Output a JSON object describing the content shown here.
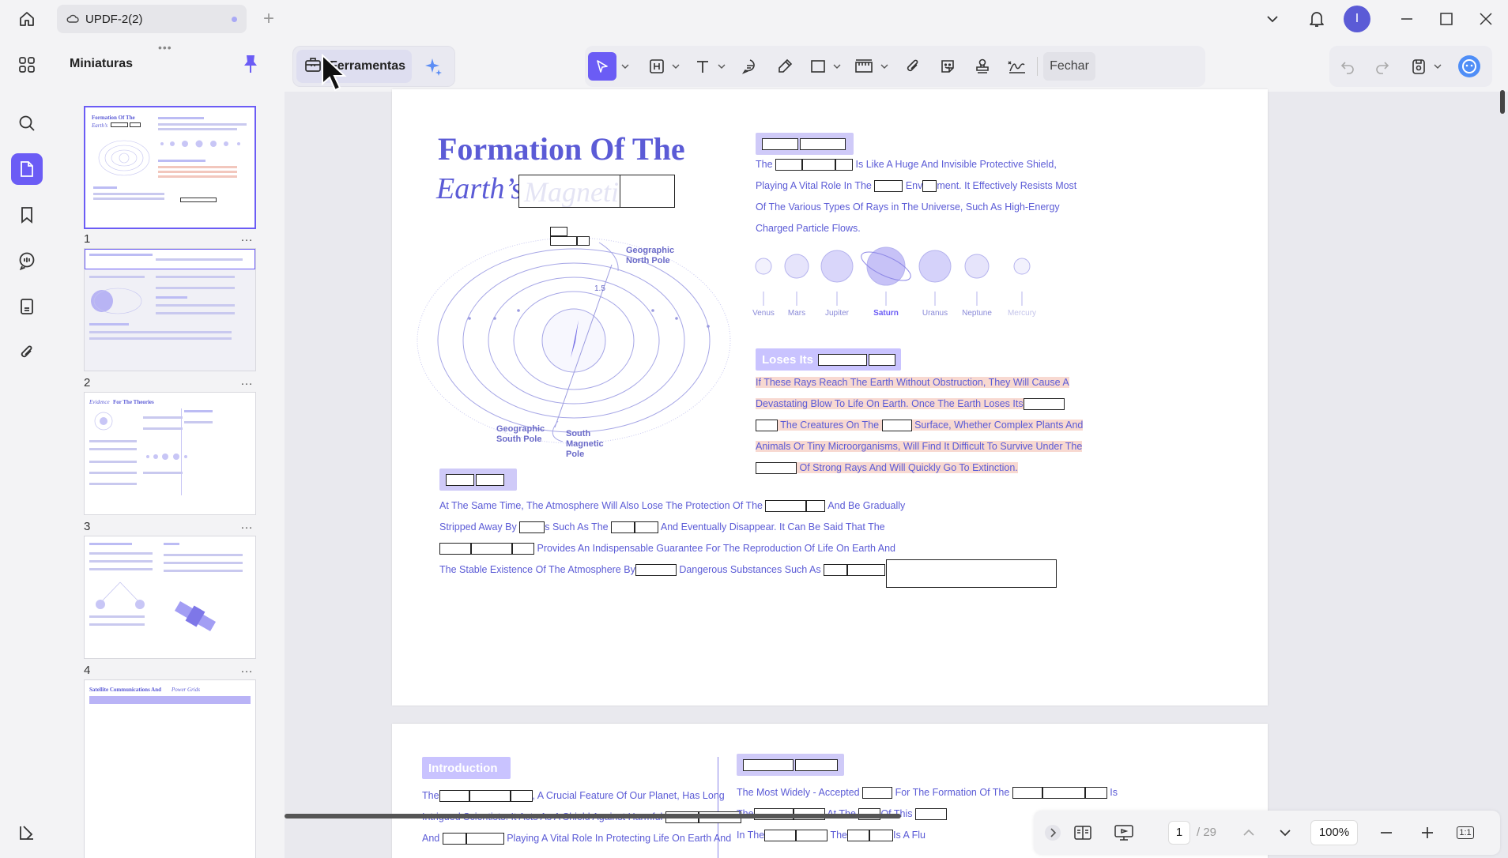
{
  "titlebar": {
    "doc_tab_label": "UPDF-2(2)",
    "add_tab": "+",
    "avatar_letter": "I"
  },
  "thumbnails": {
    "title": "Miniaturas",
    "grip": "•••",
    "pages": [
      {
        "number": "1",
        "selected": true
      },
      {
        "number": "2",
        "selected": false
      },
      {
        "number": "3",
        "selected": false
      },
      {
        "number": "4",
        "selected": false
      }
    ],
    "more": "…",
    "thumb1_title_line1": "Formation Of The",
    "thumb1_title_line2": "Earth’s",
    "thumb3_title_a": "Evidence",
    "thumb3_title_b": "For The Theories",
    "thumb5_title_a": "Satellite Communications And",
    "thumb5_title_b": "Power Grids"
  },
  "toolbar": {
    "ferramentas_label": "Ferramentas",
    "fechar_label": "Fechar"
  },
  "page1": {
    "title_line1": "Formation Of The",
    "title_line2": "Earth’s",
    "title_ghost": "Magnetic Field",
    "para1": {
      "l1_a": "The",
      "l1_b": "Is Like A Huge And Invisible Protective Shield,",
      "l2_a": "Playing A Vital Role In The",
      "l2_b": "Env",
      "l2_c": "ment. It Effectively Resists Most",
      "l3": "Of The Various Types Of Rays in The Universe, Such As High-Energy",
      "l4": "Charged Particle Flows."
    },
    "planets": [
      "Venus",
      "Mars",
      "Jupiter",
      "Saturn",
      "Uranus",
      "Neptune",
      "Mercury"
    ],
    "diagram": {
      "north_label_1": "Geographic",
      "north_label_2": "North Pole",
      "angle_label": "1.5",
      "south_geo_1": "Geographic",
      "south_geo_2": "South Pole",
      "south_mag_1": "South",
      "south_mag_2": "Magnetic",
      "south_mag_3": "Pole"
    },
    "loses_tag": "Loses Its",
    "para2": {
      "l1": "If These Rays Reach The Earth Without Obstruction, They Will Cause A",
      "l2": "Devastating Blow To Life On Earth. Once The Earth Loses Its",
      "l3_a": "The Creatures On The",
      "l3_b": "Surface, Whether Complex Plants And",
      "l4": "Animals Or Tiny Microorganisms, Will Find It Difficult To Survive Under The",
      "l5": "Of Strong Rays And Will Quickly Go To Extinction."
    },
    "para3": {
      "l1_a": "At The Same Time, The Atmosphere Will Also Lose The Protection Of The",
      "l1_b": "And Be Gradually",
      "l2_a": "Stripped Away By",
      "l2_b": "s Such As The",
      "l2_c": "And Eventually Disappear. It Can Be Said That The",
      "l3": "Provides An Indispensable Guarantee For The Reproduction Of Life On Earth And",
      "l4_a": "The Stable Existence Of The Atmosphere By",
      "l4_b": "Dangerous Substances Such As",
      "l4_c": "."
    }
  },
  "page2": {
    "intro_tag": "Introduction",
    "left": {
      "l1_a": "The",
      "l1_b": ", A Crucial Feature Of Our Planet, Has Long",
      "l2": "Intrigued Scientists. It Acts As A Shield Against Harmful",
      "l3_a": "And",
      "l3_b": "Playing A Vital Role In Protecting Life On Earth And"
    },
    "right": {
      "l1_a": "The Most Widely - Accepted",
      "l1_b": "For The Formation Of The",
      "l1_c": "Is",
      "l2_a": "The",
      "l2_b": "At The",
      "l2_c": "Of This",
      "l3_a": "In The",
      "l3_b": "The",
      "l3_c": "Is A Flu"
    }
  },
  "bottom_nav": {
    "current_page": "1",
    "total": "/ 29",
    "zoom": "100%",
    "fit_label": "1:1"
  },
  "colors": {
    "accent": "#6b5cf5",
    "text_purple": "#5b5bd6",
    "highlight": "#f8d9d1",
    "tag_bg": "#c9c3ff"
  }
}
